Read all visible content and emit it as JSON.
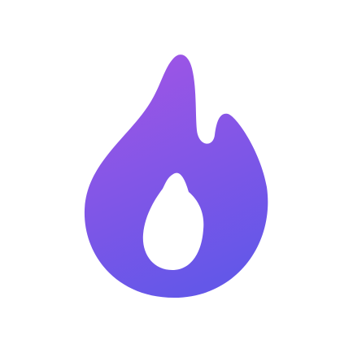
{
  "logo": {
    "icon": "flame-icon",
    "colors": {
      "gradient_top": "#9B55E6",
      "gradient_bottom": "#6457E8",
      "inner_drop": "#ffffff",
      "background": "#ffffff"
    }
  }
}
